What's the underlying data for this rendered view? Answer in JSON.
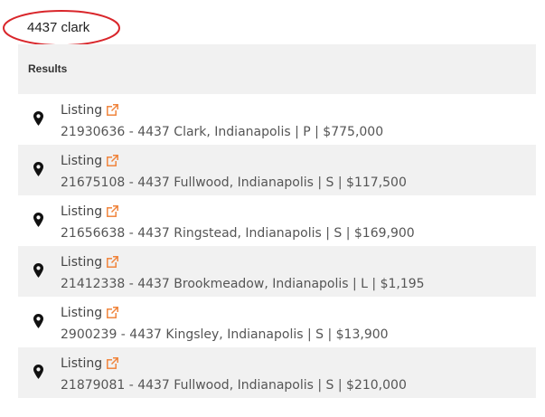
{
  "search": {
    "query": "4437 clark",
    "highlight_color": "#d9262b"
  },
  "results": {
    "title": "Results",
    "items": [
      {
        "label": "Listing",
        "detail": "21930636 - 4437 Clark, Indianapolis | P | $775,000"
      },
      {
        "label": "Listing",
        "detail": "21675108 - 4437 Fullwood, Indianapolis | S | $117,500"
      },
      {
        "label": "Listing",
        "detail": "21656638 - 4437 Ringstead, Indianapolis | S | $169,900"
      },
      {
        "label": "Listing",
        "detail": "21412338 - 4437 Brookmeadow, Indianapolis | L | $1,195"
      },
      {
        "label": "Listing",
        "detail": "2900239 - 4437 Kingsley, Indianapolis | S | $13,900"
      },
      {
        "label": "Listing",
        "detail": "21879081 - 4437 Fullwood, Indianapolis | S | $210,000"
      }
    ]
  },
  "icons": {
    "pin": "map-pin-icon",
    "external": "external-link-icon"
  },
  "colors": {
    "accent": "#f0843c",
    "row_alt_bg": "#f1f1f1"
  }
}
